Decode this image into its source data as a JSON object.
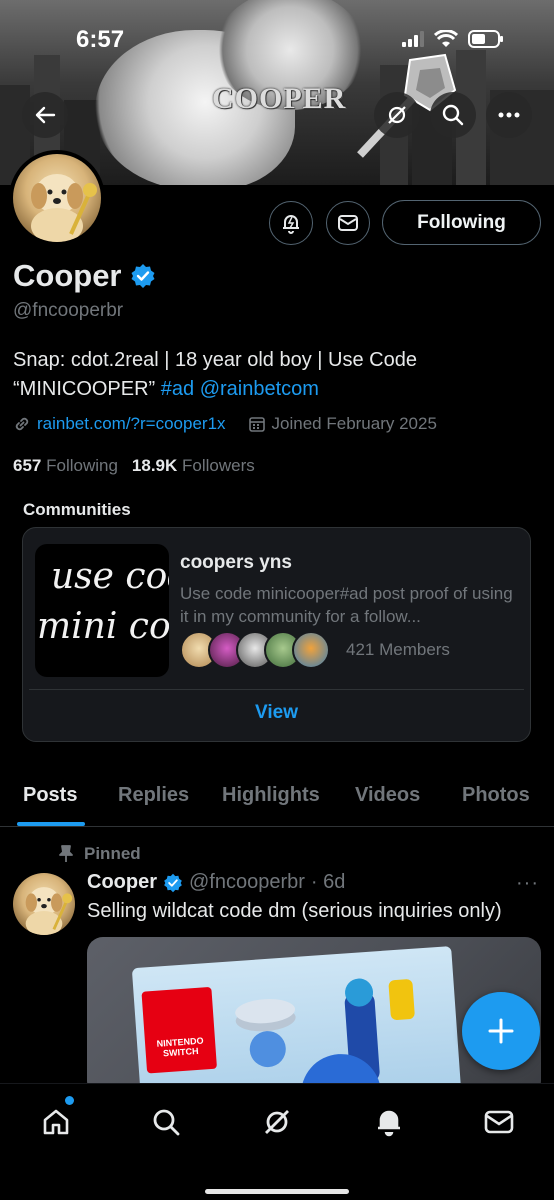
{
  "status_bar": {
    "time": "6:57"
  },
  "banner": {
    "logo_text": "COOPER"
  },
  "profile": {
    "name": "Cooper",
    "handle": "@fncooperbr",
    "following_button": "Following",
    "bio_line1": "Snap: cdot.2real | 18 year old boy | Use Code",
    "bio_line2_prefix": "“MINICOOPER”",
    "bio_hashtag": "#ad",
    "bio_mention": "@rainbetcom",
    "website": "rainbet.com/?r=cooper1x",
    "joined": "Joined February 2025",
    "following_count": "657",
    "following_label": "Following",
    "followers_count": "18.9K",
    "followers_label": "Followers"
  },
  "communities": {
    "title": "Communities",
    "card": {
      "image_line1": "use code",
      "image_line2": "mini cooper",
      "name": "coopers yns",
      "description": "Use code minicooper#ad post proof of using it in my community for a follow...",
      "members": "421 Members",
      "view_label": "View"
    }
  },
  "tabs": [
    "Posts",
    "Replies",
    "Highlights",
    "Videos",
    "Photos"
  ],
  "post": {
    "pinned_label": "Pinned",
    "name": "Cooper",
    "handle": "@fncooperbr",
    "time": "· 6d",
    "more": "···",
    "text": "Selling wildcat code dm (serious inquiries only)",
    "media_brand": "NINTENDO SWITCH"
  },
  "colors": {
    "accent": "#1d9bf0",
    "background": "#000000",
    "muted": "#71767b",
    "card": "#16181c"
  },
  "icons": {
    "back": "arrow-left-icon",
    "grok": "grok-icon",
    "search": "search-icon",
    "more": "more-icon",
    "notify": "notification-bell-icon",
    "message": "envelope-icon",
    "verified": "verified-badge-icon",
    "link": "link-icon",
    "calendar": "calendar-icon",
    "pin": "pin-icon",
    "compose": "plus-icon",
    "nav": [
      "home-icon",
      "search-icon",
      "grok-icon",
      "bell-icon",
      "envelope-icon"
    ]
  }
}
